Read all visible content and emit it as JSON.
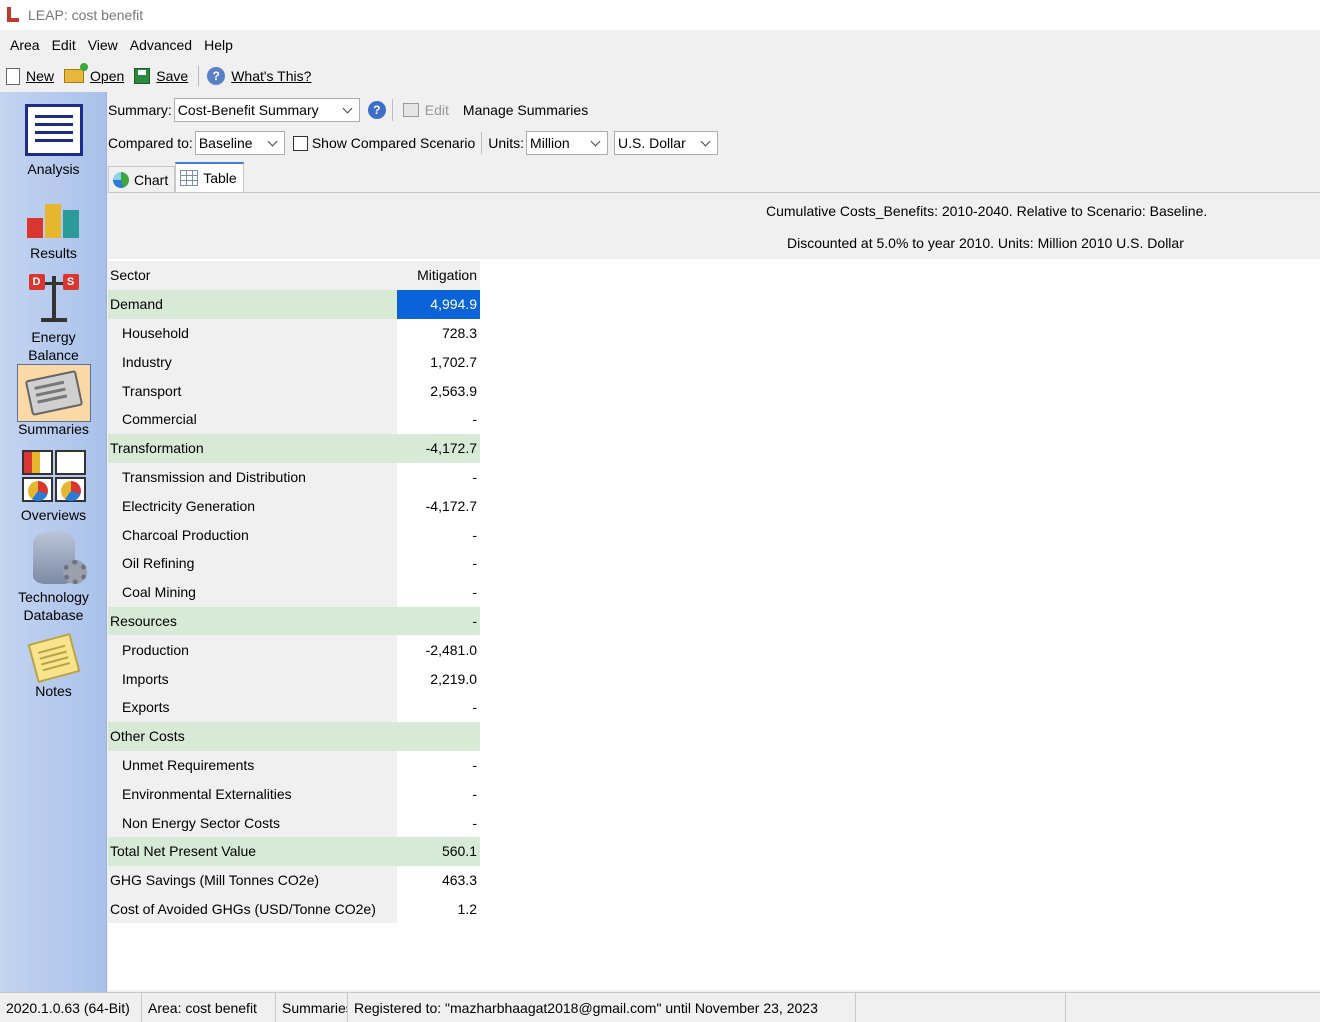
{
  "window": {
    "title": "LEAP: cost benefit"
  },
  "menu": [
    "Area",
    "Edit",
    "View",
    "Advanced",
    "Help"
  ],
  "toolbar": {
    "new": "New",
    "open": "Open",
    "save": "Save",
    "whats_this": "What's This?"
  },
  "sidebar": {
    "analysis": "Analysis",
    "results": "Results",
    "energy_balance_1": "Energy",
    "energy_balance_2": "Balance",
    "summaries": "Summaries",
    "overviews": "Overviews",
    "techdb_1": "Technology",
    "techdb_2": "Database",
    "notes": "Notes"
  },
  "controls": {
    "summary_label": "Summary:",
    "summary_value": "Cost-Benefit Summary",
    "edit": "Edit",
    "manage": "Manage Summaries",
    "compared_label": "Compared to:",
    "compared_value": "Baseline",
    "show_compared": "Show Compared Scenario",
    "units_label": "Units:",
    "units_value": "Million",
    "currency_value": "U.S. Dollar"
  },
  "tabs": {
    "chart": "Chart",
    "table": "Table"
  },
  "caption": {
    "line1": "Cumulative Costs_Benefits: 2010-2040. Relative to Scenario: Baseline.",
    "line2": "Discounted at 5.0% to year 2010.  Units: Million 2010 U.S. Dollar"
  },
  "table": {
    "col_sector": "Sector",
    "col_mitigation": "Mitigation",
    "rows": [
      {
        "label": "Demand",
        "value": "4,994.9"
      },
      {
        "label": "Household",
        "value": "728.3"
      },
      {
        "label": "Industry",
        "value": "1,702.7"
      },
      {
        "label": "Transport",
        "value": "2,563.9"
      },
      {
        "label": "Commercial",
        "value": "-"
      },
      {
        "label": "Transformation",
        "value": "-4,172.7"
      },
      {
        "label": "Transmission and Distribution",
        "value": "-"
      },
      {
        "label": "Electricity Generation",
        "value": "-4,172.7"
      },
      {
        "label": "Charcoal Production",
        "value": "-"
      },
      {
        "label": "Oil Refining",
        "value": "-"
      },
      {
        "label": "Coal Mining",
        "value": "-"
      },
      {
        "label": "Resources",
        "value": "-"
      },
      {
        "label": "Production",
        "value": "-2,481.0"
      },
      {
        "label": "Imports",
        "value": "2,219.0"
      },
      {
        "label": "Exports",
        "value": "-"
      },
      {
        "label": "Other Costs",
        "value": ""
      },
      {
        "label": "Unmet Requirements",
        "value": "-"
      },
      {
        "label": "Environmental Externalities",
        "value": "-"
      },
      {
        "label": "Non Energy Sector Costs",
        "value": "-"
      },
      {
        "label": "Total Net Present Value",
        "value": "560.1"
      },
      {
        "label": "GHG Savings (Mill Tonnes CO2e)",
        "value": "463.3"
      },
      {
        "label": "Cost of Avoided GHGs (USD/Tonne CO2e)",
        "value": "1.2"
      }
    ]
  },
  "status": {
    "version": "2020.1.0.63 (64-Bit)",
    "area": "Area: cost benefit",
    "view": "Summaries",
    "registered": "Registered to: \"mazharbhaagat2018@gmail.com\" until November 23, 2023"
  },
  "colors": {
    "group_row": "#d7ead6",
    "selected_cell": "#0a63d8",
    "sidebar": "#b5caee"
  }
}
